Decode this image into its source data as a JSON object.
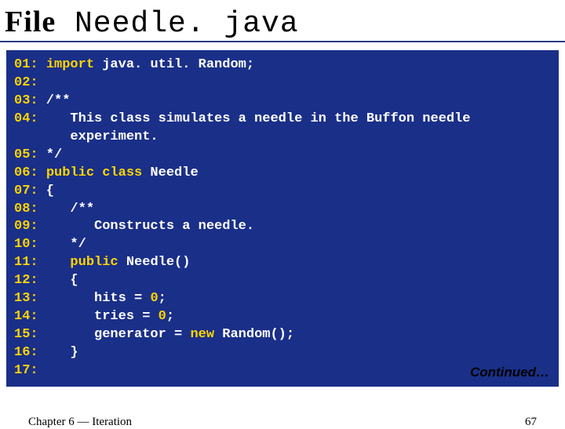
{
  "title": {
    "word1": "File",
    "rest": " Needle. java"
  },
  "code": {
    "lines": [
      {
        "ln": "01:",
        "pre": " ",
        "kw": "import",
        "post": " java. util. Random;"
      },
      {
        "ln": "02:",
        "pre": "",
        "kw": "",
        "post": ""
      },
      {
        "ln": "03:",
        "pre": " /**",
        "kw": "",
        "post": ""
      },
      {
        "ln": "04:",
        "pre": "    This class simulates a needle in the Buffon needle",
        "kw": "",
        "post": ""
      },
      {
        "ln": "",
        "pre": "       experiment.",
        "kw": "",
        "post": ""
      },
      {
        "ln": "05:",
        "pre": " */",
        "kw": "",
        "post": ""
      },
      {
        "ln": "06:",
        "pre": " ",
        "kw": "public class",
        "post": " Needle"
      },
      {
        "ln": "07:",
        "pre": " {",
        "kw": "",
        "post": ""
      },
      {
        "ln": "08:",
        "pre": "    /**",
        "kw": "",
        "post": ""
      },
      {
        "ln": "09:",
        "pre": "       Constructs a needle.",
        "kw": "",
        "post": ""
      },
      {
        "ln": "10:",
        "pre": "    */",
        "kw": "",
        "post": ""
      },
      {
        "ln": "11:",
        "pre": "    ",
        "kw": "public",
        "post": " Needle()"
      },
      {
        "ln": "12:",
        "pre": "    {",
        "kw": "",
        "post": ""
      },
      {
        "ln": "13:",
        "pre": "       hits = ",
        "kw": "0",
        "post": ";"
      },
      {
        "ln": "14:",
        "pre": "       tries = ",
        "kw": "0",
        "post": ";"
      },
      {
        "ln": "15:",
        "pre": "       generator = ",
        "kw": "new",
        "post": " Random();"
      },
      {
        "ln": "16:",
        "pre": "    }",
        "kw": "",
        "post": ""
      },
      {
        "ln": "17:",
        "pre": "",
        "kw": "",
        "post": ""
      }
    ],
    "continued": "Continued…"
  },
  "footer": {
    "chapter": "Chapter 6 — Iteration",
    "pagenum": "67"
  }
}
